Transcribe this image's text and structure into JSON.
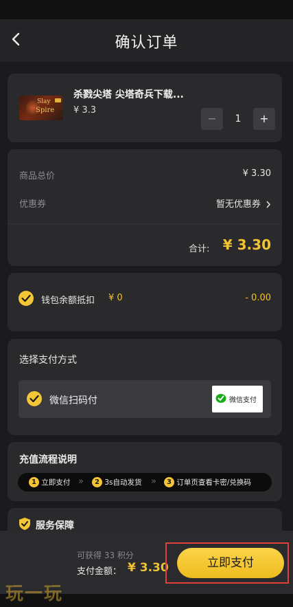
{
  "header": {
    "title": "确认订单"
  },
  "product": {
    "name": "杀戮尖塔 尖塔奇兵下载...",
    "price": "¥ 3.3",
    "quantity": "1",
    "minus": "−",
    "plus": "+",
    "thumb_text_1": "Slay",
    "thumb_text_2": "Spire"
  },
  "summary": {
    "total_label": "商品总价",
    "total_value": "¥ 3.30",
    "coupon_label": "优惠券",
    "coupon_value": "暂无优惠券",
    "sum_label": "合计:",
    "sum_value": "¥ 3.30"
  },
  "wallet": {
    "label": "钱包余额抵扣",
    "balance": "¥ 0",
    "deduction": "- 0.00"
  },
  "payment": {
    "section_title": "选择支付方式",
    "method": "微信扫码付",
    "badge": "微信支付"
  },
  "process": {
    "title": "充值流程说明",
    "steps": [
      {
        "num": "1",
        "label": "立即支付"
      },
      {
        "num": "2",
        "label": "3s自动发货"
      },
      {
        "num": "3",
        "label": "订单页查看卡密/兑换码"
      }
    ],
    "separator": "»"
  },
  "guarantee": {
    "title": "服务保障"
  },
  "footer": {
    "points": "可获得 33 积分",
    "amount_label": "支付金额：",
    "amount_value": "¥ 3.30",
    "pay_button": "立即支付"
  },
  "watermark": {
    "text": "玩一玩"
  },
  "colors": {
    "accent": "#f4c534",
    "highlight_box": "#e0403a",
    "wechat_green": "#1aad19"
  }
}
